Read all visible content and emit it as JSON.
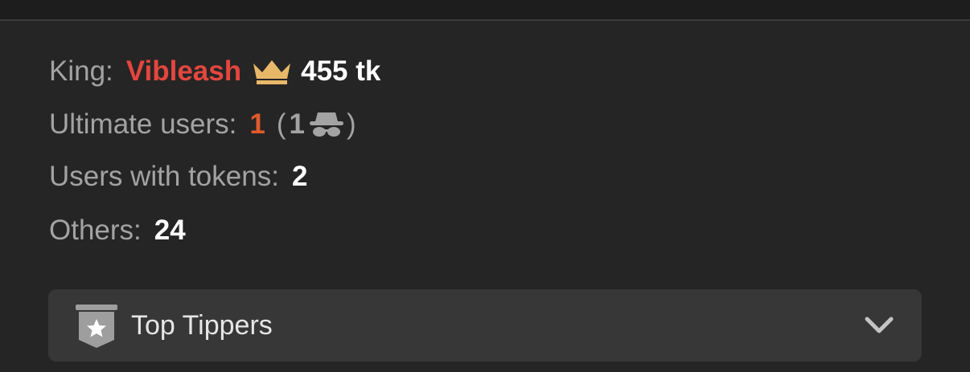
{
  "stats": {
    "king": {
      "label": "King:",
      "name": "Vibleash",
      "crown_icon": "crown-icon",
      "amount": "455 tk"
    },
    "ultimate": {
      "label": "Ultimate users:",
      "value": "1",
      "paren_open": "(",
      "anon_count": "1",
      "anon_icon": "incognito-icon",
      "paren_close": ")"
    },
    "tokens": {
      "label": "Users with tokens:",
      "value": "2"
    },
    "others": {
      "label": "Others:",
      "value": "24"
    }
  },
  "dropdown": {
    "icon": "star-badge-icon",
    "label": "Top Tippers",
    "chevron": "chevron-down-icon"
  },
  "colors": {
    "background": "#252525",
    "king_name": "#e4463e",
    "ultimate_value": "#e05a2b",
    "crown": "#e8b869",
    "dropdown_bg": "#373737"
  }
}
